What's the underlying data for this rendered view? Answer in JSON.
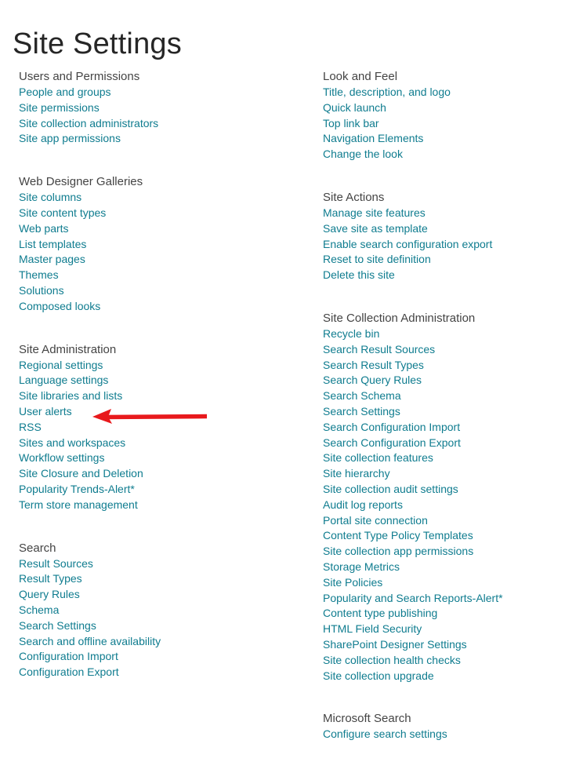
{
  "page": {
    "title": "Site Settings"
  },
  "colors": {
    "link": "#0f7c8f",
    "heading": "#444444",
    "title": "#262626",
    "annotation_arrow": "#e8191c",
    "background": "#ffffff"
  },
  "annotation": {
    "type": "arrow",
    "direction": "left",
    "color": "#e8191c",
    "points_to": "User alerts"
  },
  "columns": {
    "left": [
      {
        "heading": "Users and Permissions",
        "links": [
          "People and groups",
          "Site permissions",
          "Site collection administrators",
          "Site app permissions"
        ]
      },
      {
        "heading": "Web Designer Galleries",
        "links": [
          "Site columns",
          "Site content types",
          "Web parts",
          "List templates",
          "Master pages",
          "Themes",
          "Solutions",
          "Composed looks"
        ]
      },
      {
        "heading": "Site Administration",
        "links": [
          "Regional settings",
          "Language settings",
          "Site libraries and lists",
          "User alerts",
          "RSS",
          "Sites and workspaces",
          "Workflow settings",
          "Site Closure and Deletion",
          "Popularity Trends-Alert*",
          "Term store management"
        ]
      },
      {
        "heading": "Search",
        "links": [
          "Result Sources",
          "Result Types",
          "Query Rules",
          "Schema",
          "Search Settings",
          "Search and offline availability",
          "Configuration Import",
          "Configuration Export"
        ]
      }
    ],
    "right": [
      {
        "heading": "Look and Feel",
        "links": [
          "Title, description, and logo",
          "Quick launch",
          "Top link bar",
          "Navigation Elements",
          "Change the look"
        ]
      },
      {
        "heading": "Site Actions",
        "links": [
          "Manage site features",
          "Save site as template",
          "Enable search configuration export",
          "Reset to site definition",
          "Delete this site"
        ]
      },
      {
        "heading": "Site Collection Administration",
        "links": [
          "Recycle bin",
          "Search Result Sources",
          "Search Result Types",
          "Search Query Rules",
          "Search Schema",
          "Search Settings",
          "Search Configuration Import",
          "Search Configuration Export",
          "Site collection features",
          "Site hierarchy",
          "Site collection audit settings",
          "Audit log reports",
          "Portal site connection",
          "Content Type Policy Templates",
          "Site collection app permissions",
          "Storage Metrics",
          "Site Policies",
          "Popularity and Search Reports-Alert*",
          "Content type publishing",
          "HTML Field Security",
          "SharePoint Designer Settings",
          "Site collection health checks",
          "Site collection upgrade"
        ]
      },
      {
        "heading": "Microsoft Search",
        "links": [
          "Configure search settings"
        ]
      }
    ]
  }
}
